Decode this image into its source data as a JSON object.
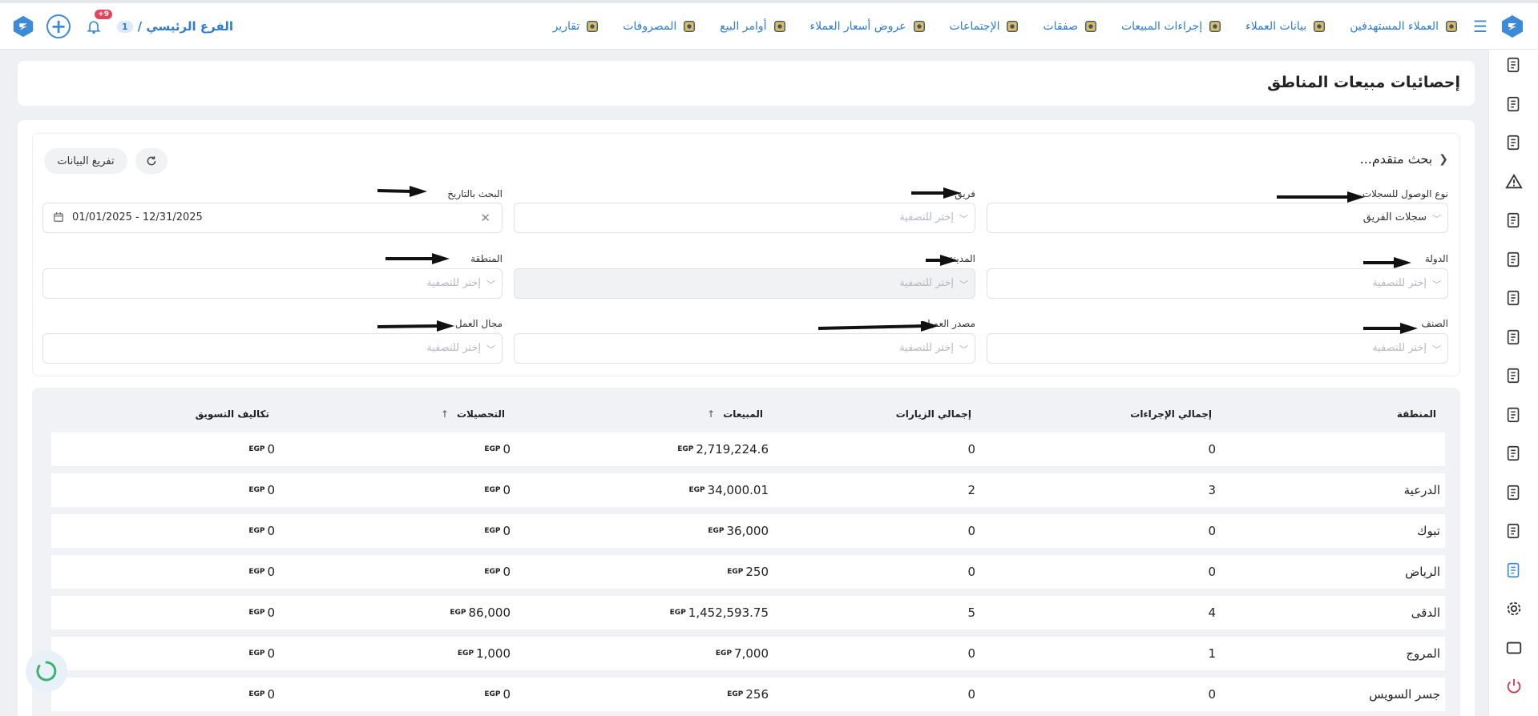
{
  "topbar": {
    "nav": [
      {
        "label": "العملاء المستهدفين",
        "icon": "target-customers-icon"
      },
      {
        "label": "بيانات العملاء",
        "icon": "customer-data-icon"
      },
      {
        "label": "إجراءات المبيعات",
        "icon": "sales-actions-icon"
      },
      {
        "label": "صفقات",
        "icon": "deals-icon"
      },
      {
        "label": "الإجتماعات",
        "icon": "meetings-icon"
      },
      {
        "label": "عروض أسعار العملاء",
        "icon": "quotations-icon"
      },
      {
        "label": "أوامر البيع",
        "icon": "sales-orders-icon"
      },
      {
        "label": "المصروفات",
        "icon": "expenses-icon"
      },
      {
        "label": "تقارير",
        "icon": "reports-icon"
      }
    ],
    "branch": {
      "name": "الفرع الرئيسي /",
      "number": "1"
    },
    "notifications": "+9"
  },
  "page": {
    "title": "إحصائيات مبيعات المناطق"
  },
  "filters": {
    "advanced_label": "بحث متقدم...",
    "clear_button": "تفريغ البيانات",
    "access_type": {
      "label": "نوع الوصول للسجلات",
      "value": "سجلات الفريق"
    },
    "team": {
      "label": "فريق",
      "placeholder": "إختر للتصفية"
    },
    "date": {
      "label": "البحث بالتاريخ",
      "value": "01/01/2025 - 12/31/2025"
    },
    "country": {
      "label": "الدولة",
      "placeholder": "إختر للتصفية"
    },
    "city": {
      "label": "المدينة",
      "placeholder": "إختر للتصفية"
    },
    "region": {
      "label": "المنطقة",
      "placeholder": "إختر للتصفية"
    },
    "category": {
      "label": "الصنف",
      "placeholder": "إختر للتصفية"
    },
    "source": {
      "label": "مصدر العميل",
      "placeholder": "إختر للتصفية"
    },
    "field": {
      "label": "مجال العمل",
      "placeholder": "إختر للتصفية"
    }
  },
  "table": {
    "currency": "EGP",
    "headers": {
      "region": "المنطقة",
      "actions": "إجمالي الإجراءات",
      "visits": "إجمالي الزيارات",
      "sales": "المبيعات",
      "collections": "التحصيلات",
      "marketing": "تكاليف التسويق"
    },
    "rows": [
      {
        "region": "",
        "actions": "0",
        "visits": "0",
        "sales": "2,719,224.6",
        "collections": "0",
        "marketing": "0"
      },
      {
        "region": "الدرعية",
        "actions": "3",
        "visits": "2",
        "sales": "34,000.01",
        "collections": "0",
        "marketing": "0"
      },
      {
        "region": "تبوك",
        "actions": "0",
        "visits": "0",
        "sales": "36,000",
        "collections": "0",
        "marketing": "0"
      },
      {
        "region": "الرياض",
        "actions": "0",
        "visits": "0",
        "sales": "250",
        "collections": "0",
        "marketing": "0"
      },
      {
        "region": "الدقى",
        "actions": "4",
        "visits": "5",
        "sales": "1,452,593.75",
        "collections": "86,000",
        "marketing": "0"
      },
      {
        "region": "المروج",
        "actions": "1",
        "visits": "0",
        "sales": "7,000",
        "collections": "1,000",
        "marketing": "0"
      },
      {
        "region": "جسر السويس",
        "actions": "0",
        "visits": "0",
        "sales": "256",
        "collections": "0",
        "marketing": "0"
      }
    ]
  }
}
